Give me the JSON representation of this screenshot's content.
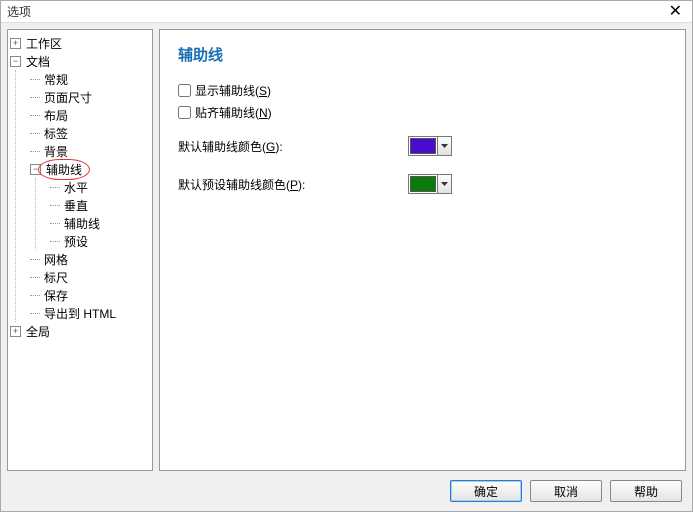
{
  "window": {
    "title": "选项",
    "close": "✕"
  },
  "tree": {
    "workspace": "工作区",
    "document": "文档",
    "doc_children": {
      "general": "常规",
      "page_size": "页面尺寸",
      "layout": "布局",
      "labels": "标签",
      "background": "背景",
      "guides": "辅助线",
      "guides_children": {
        "horizontal": "水平",
        "vertical": "垂直",
        "guides2": "辅助线",
        "presets": "预设"
      },
      "grid": "网格",
      "rulers": "标尺",
      "save": "保存",
      "export_html": "导出到 HTML"
    },
    "global": "全局"
  },
  "panel": {
    "heading": "辅助线",
    "show_guides": "显示辅助线(",
    "show_guides_key": "S",
    "show_guides_end": ")",
    "snap_guides": "贴齐辅助线(",
    "snap_guides_key": "N",
    "snap_guides_end": ")",
    "default_color": "默认辅助线颜色(",
    "default_color_key": "G",
    "default_color_end": "):",
    "preset_color": "默认预设辅助线颜色(",
    "preset_color_key": "P",
    "preset_color_end": "):",
    "colors": {
      "guide": "#4a0cd0",
      "preset": "#0a7a0a"
    }
  },
  "buttons": {
    "ok": "确定",
    "cancel": "取消",
    "help": "帮助"
  }
}
